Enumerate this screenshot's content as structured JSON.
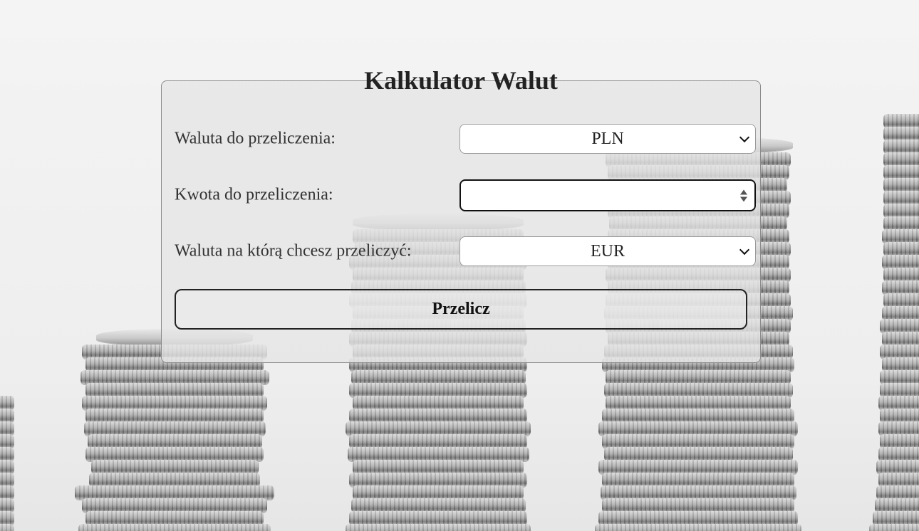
{
  "app": {
    "title": "Kalkulator Walut"
  },
  "form": {
    "from_currency": {
      "label": "Waluta do przeliczenia:",
      "value": "PLN"
    },
    "amount": {
      "label": "Kwota do przeliczenia:",
      "value": ""
    },
    "to_currency": {
      "label": "Waluta na którą chcesz przeliczyć:",
      "value": "EUR"
    },
    "submit_label": "Przelicz"
  },
  "icons": {
    "select_arrow": "chevron-down-icon",
    "number_spinner": "spinner-icon"
  },
  "colors": {
    "panel_bg": "#e6e6e6",
    "text": "#222222",
    "field_bg": "#ffffff"
  }
}
